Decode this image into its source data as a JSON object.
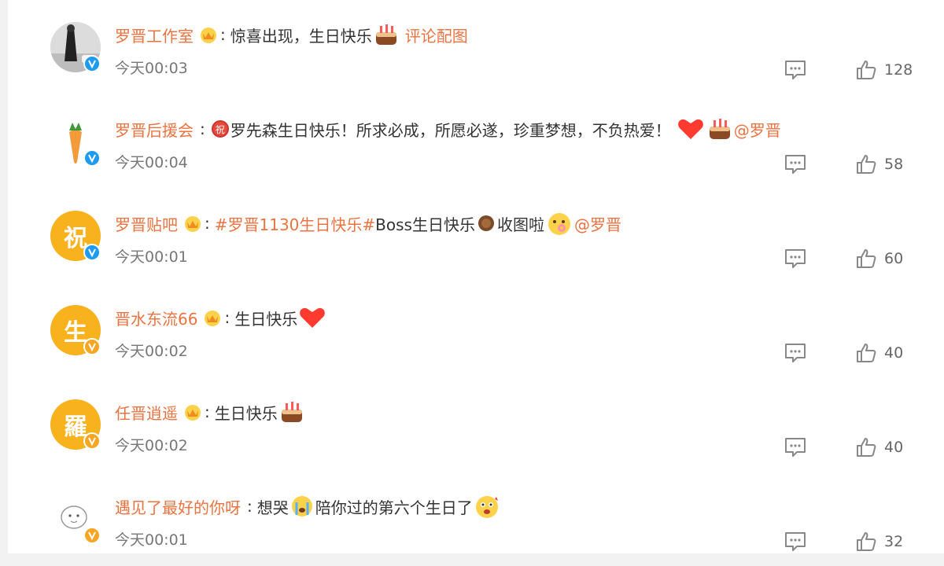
{
  "colors": {
    "name": "#eb7340",
    "text": "#333333",
    "meta": "#777777",
    "verified_blue": "#1e9bef",
    "verified_gold": "#f5a623"
  },
  "comments": [
    {
      "name": "罗晋工作室",
      "text": "惊喜出现，生日快乐",
      "link": "评论配图",
      "time": "今天00:03",
      "likes": "128",
      "avatar": "photo-avatar",
      "verified": "blue"
    },
    {
      "name": "罗晋后援会",
      "badge_char": "祝",
      "text": "罗先森生日快乐！所求必成，所愿必遂，珍重梦想，不负热爱！",
      "mention": "@罗晋",
      "time": "今天00:04",
      "likes": "58",
      "avatar": "carrot-avatar",
      "verified": "blue"
    },
    {
      "name": "罗晋贴吧",
      "hashtag": "#罗晋1130生日快乐#",
      "text_a": " Boss生日快乐",
      "text_b": "收图啦",
      "mention": "@罗晋",
      "time": "今天00:01",
      "likes": "60",
      "avatar_char": "祝",
      "verified": "blue"
    },
    {
      "name": "晋水东流66",
      "text": "生日快乐",
      "time": "今天00:02",
      "likes": "40",
      "avatar_char": "生",
      "verified": "gold"
    },
    {
      "name": "任晋逍遥",
      "text": "生日快乐",
      "time": "今天00:02",
      "likes": "40",
      "avatar_char": "羅",
      "verified": "gold"
    },
    {
      "name": "遇见了最好的你呀",
      "text_a": "想哭",
      "text_b": "陪你过的第六个生日了",
      "time": "今天00:01",
      "likes": "32",
      "avatar": "sketch-avatar",
      "verified": "gold"
    }
  ]
}
